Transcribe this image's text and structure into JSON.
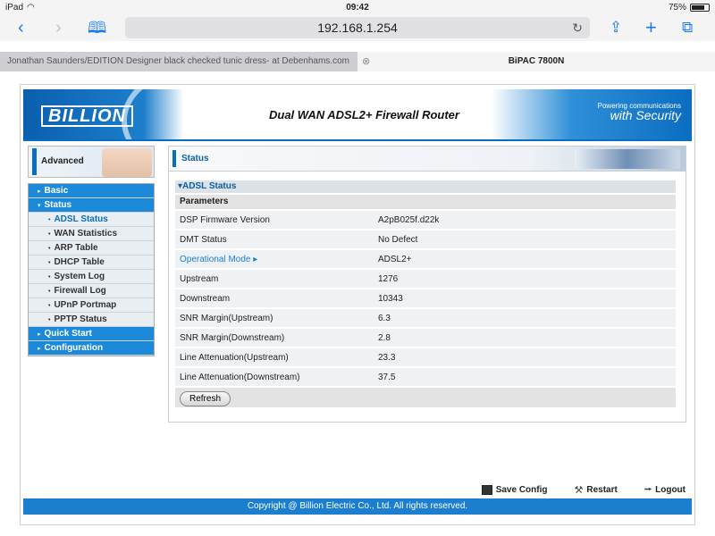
{
  "ios": {
    "device": "iPad",
    "time": "09:42",
    "battery": "75%",
    "battery_level": 0.75
  },
  "browser": {
    "url": "192.168.1.254",
    "tabs": [
      {
        "title": "Jonathan Saunders/EDITION Designer black checked tunic dress- at Debenhams.com"
      },
      {
        "title": "BiPAC 7800N"
      }
    ]
  },
  "header": {
    "logo": "BILLION",
    "title": "Dual WAN ADSL2+ Firewall Router",
    "powering_line1": "Powering communications",
    "powering_line2": "with Security"
  },
  "sidebar": {
    "section": "Advanced",
    "items": [
      {
        "label": "Basic",
        "level": "top"
      },
      {
        "label": "Status",
        "level": "top-open"
      },
      {
        "label": "ADSL Status",
        "level": "sub",
        "active": true
      },
      {
        "label": "WAN Statistics",
        "level": "sub"
      },
      {
        "label": "ARP Table",
        "level": "sub"
      },
      {
        "label": "DHCP Table",
        "level": "sub"
      },
      {
        "label": "System Log",
        "level": "sub"
      },
      {
        "label": "Firewall Log",
        "level": "sub"
      },
      {
        "label": "UPnP Portmap",
        "level": "sub"
      },
      {
        "label": "PPTP Status",
        "level": "sub"
      },
      {
        "label": "Quick Start",
        "level": "top"
      },
      {
        "label": "Configuration",
        "level": "top"
      }
    ]
  },
  "main": {
    "heading": "Status",
    "section_title": "ADSL Status",
    "params_header": "Parameters",
    "rows": [
      {
        "key": "DSP Firmware Version",
        "value": "A2pB025f.d22k"
      },
      {
        "key": "DMT Status",
        "value": "No Defect"
      },
      {
        "key": "Operational Mode",
        "value": "ADSL2+",
        "link": true
      },
      {
        "key": "Upstream",
        "value": "1276"
      },
      {
        "key": "Downstream",
        "value": "10343"
      },
      {
        "key": "SNR Margin(Upstream)",
        "value": "6.3"
      },
      {
        "key": "SNR Margin(Downstream)",
        "value": "2.8"
      },
      {
        "key": "Line Attenuation(Upstream)",
        "value": "23.3"
      },
      {
        "key": "Line Attenuation(Downstream)",
        "value": "37.5"
      }
    ],
    "refresh_label": "Refresh"
  },
  "footer": {
    "save_config": "Save Config",
    "restart": "Restart",
    "logout": "Logout",
    "copyright": "Copyright @ Billion Electric Co., Ltd. All rights reserved."
  },
  "colors": {
    "accent": "#1c8ad8",
    "ios_blue": "#1a7cf5"
  }
}
